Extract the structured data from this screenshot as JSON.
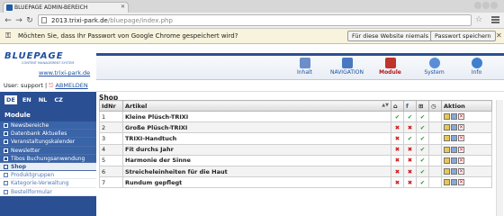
{
  "browser": {
    "tab_title": "BLUEPAGE ADMIN-BEREICH",
    "url_domain": "2013.trixi-park.de",
    "url_path": "/bluepage/index.php"
  },
  "password_bar": {
    "message": "Möchten Sie, dass Ihr Passwort von Google Chrome gespeichert wird?",
    "never_label": "Für diese Website niemals",
    "save_label": "Passwort speichern"
  },
  "sidebar": {
    "logo": "BLUEPAGE",
    "logo_subtitle": "CONTENT MANAGEMENT SYSTEM",
    "site_link": "www.trixi-park.de",
    "user_label": "User: support |",
    "logout_label": "ABMELDEN",
    "languages": [
      "DE",
      "EN",
      "NL",
      "CZ"
    ],
    "section_title": "Module",
    "menu": [
      {
        "label": "Newsbereiche"
      },
      {
        "label": "Datenbank Aktuelles"
      },
      {
        "label": "Veranstaltungskalender"
      },
      {
        "label": "Newsletter"
      },
      {
        "label": "Tibos Buchungsanwendung"
      },
      {
        "label": "Shop"
      },
      {
        "label": "Produktgruppen"
      },
      {
        "label": "Kategorie-Verwaltung"
      },
      {
        "label": "Bestellformular"
      }
    ]
  },
  "topnav": [
    {
      "label": "Inhalt",
      "color": "#6c8fc9"
    },
    {
      "label": "NAVIGATION",
      "color": "#4a78c0"
    },
    {
      "label": "Module",
      "color": "#c0342b"
    },
    {
      "label": "System",
      "color": "#5a8fd6"
    },
    {
      "label": "Info",
      "color": "#3f7fd0"
    }
  ],
  "main": {
    "title": "Shop",
    "headers": {
      "id": "IdNr",
      "article": "Artikel",
      "action": "Aktion"
    },
    "rows": [
      {
        "id": "1",
        "name": "Kleine Plüsch-TRIXI",
        "c1": "✔",
        "c2": "✔",
        "c3": "✔",
        "c4": ""
      },
      {
        "id": "2",
        "name": "Große Plüsch-TRIXI",
        "c1": "✖",
        "c2": "✖",
        "c3": "✔",
        "c4": ""
      },
      {
        "id": "3",
        "name": "TRIXI-Handtuch",
        "c1": "✖",
        "c2": "✔",
        "c3": "✔",
        "c4": ""
      },
      {
        "id": "4",
        "name": "Fit durchs Jahr",
        "c1": "✖",
        "c2": "✖",
        "c3": "✔",
        "c4": ""
      },
      {
        "id": "5",
        "name": "Harmonie der Sinne",
        "c1": "✖",
        "c2": "✖",
        "c3": "✔",
        "c4": ""
      },
      {
        "id": "6",
        "name": "Streicheleinheiten für die Haut",
        "c1": "✖",
        "c2": "✖",
        "c3": "✔",
        "c4": ""
      },
      {
        "id": "7",
        "name": "Rundum gepflegt",
        "c1": "✖",
        "c2": "✖",
        "c3": "✔",
        "c4": ""
      }
    ]
  }
}
